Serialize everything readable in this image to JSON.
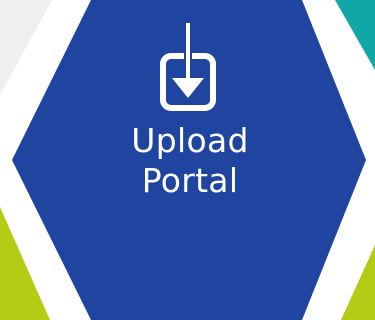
{
  "tile": {
    "label_line1": "Upload",
    "label_line2": "Portal",
    "icon": "download-tray-icon"
  },
  "colors": {
    "hexagon_fill": "#1f45a1",
    "border": "#ffffff",
    "top_left_gray": "#efefef",
    "top_right_teal": "#0fa8a6",
    "bottom_lime": "#b3cd14",
    "text": "#ffffff"
  }
}
